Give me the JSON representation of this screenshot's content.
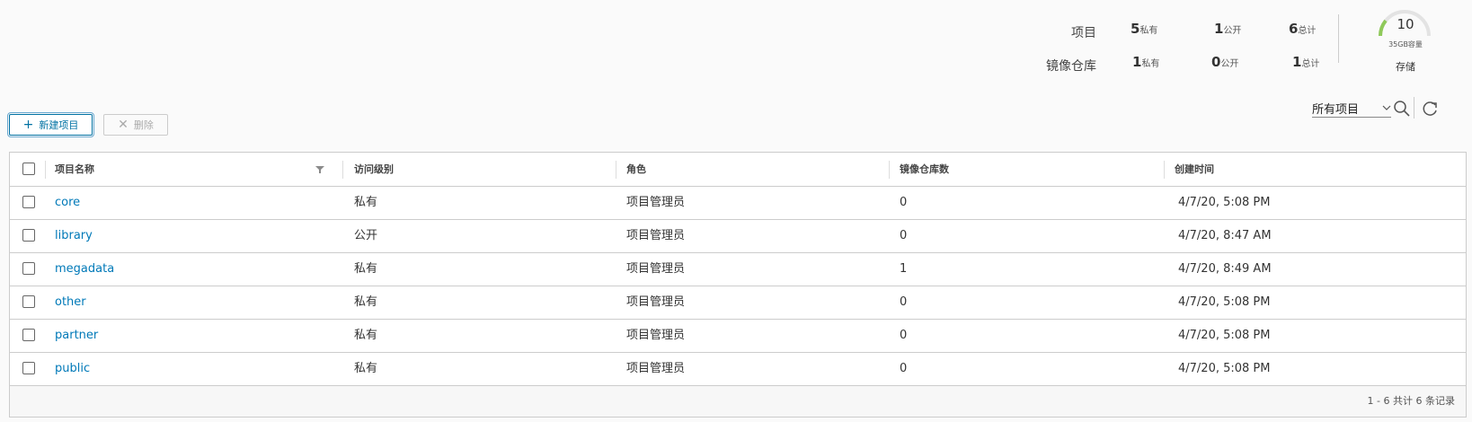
{
  "stats": {
    "rows": [
      {
        "label": "项目",
        "private": {
          "value": "5",
          "unit": "私有"
        },
        "public": {
          "value": "1",
          "unit": "公开"
        },
        "total": {
          "value": "6",
          "unit": "总计"
        }
      },
      {
        "label": "镜像仓库",
        "private": {
          "value": "1",
          "unit": "私有"
        },
        "public": {
          "value": "0",
          "unit": "公开"
        },
        "total": {
          "value": "1",
          "unit": "总计"
        }
      }
    ],
    "storage": {
      "value": "10",
      "capacity": "35GB容量",
      "label": "存储",
      "gauge_color": "#8fc95a"
    }
  },
  "toolbar": {
    "new_project_label": "新建项目",
    "new_project_icon": "plus-icon",
    "delete_label": "删除",
    "delete_icon": "close-icon",
    "filter_selected": "所有项目",
    "search_icon": "search-icon",
    "refresh_icon": "refresh-icon"
  },
  "table": {
    "columns": [
      "项目名称",
      "访问级别",
      "角色",
      "镜像仓库数",
      "创建时间"
    ],
    "rows": [
      {
        "name": "core",
        "access": "私有",
        "role": "项目管理员",
        "repos": "0",
        "created": "4/7/20, 5:08 PM"
      },
      {
        "name": "library",
        "access": "公开",
        "role": "项目管理员",
        "repos": "0",
        "created": "4/7/20, 8:47 AM"
      },
      {
        "name": "megadata",
        "access": "私有",
        "role": "项目管理员",
        "repos": "1",
        "created": "4/7/20, 8:49 AM"
      },
      {
        "name": "other",
        "access": "私有",
        "role": "项目管理员",
        "repos": "0",
        "created": "4/7/20, 5:08 PM"
      },
      {
        "name": "partner",
        "access": "私有",
        "role": "项目管理员",
        "repos": "0",
        "created": "4/7/20, 5:08 PM"
      },
      {
        "name": "public",
        "access": "私有",
        "role": "项目管理员",
        "repos": "0",
        "created": "4/7/20, 5:08 PM"
      }
    ],
    "footer": "1 - 6 共计 6 条记录"
  },
  "colors": {
    "link": "#0079b8",
    "accent": "#0072a3"
  }
}
